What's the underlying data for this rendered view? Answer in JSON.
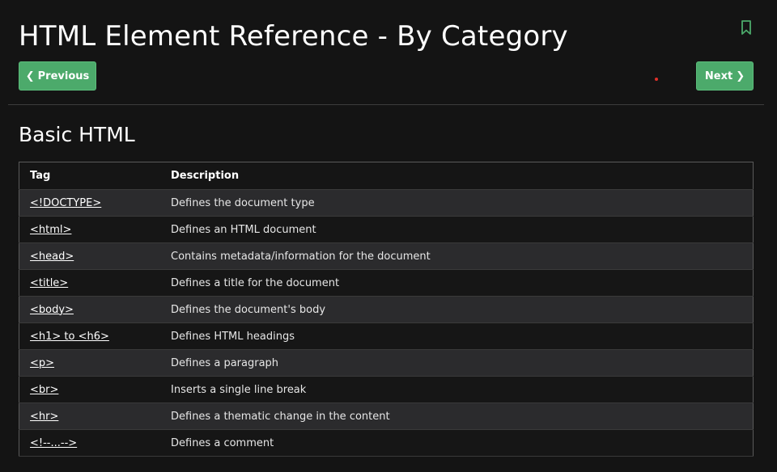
{
  "header": {
    "title": "HTML Element Reference - By Category",
    "bookmark_icon": "bookmark-icon",
    "bookmark_color": "#4caa6b"
  },
  "nav": {
    "previous_label": "Previous",
    "next_label": "Next",
    "button_color": "#4caa6b"
  },
  "section": {
    "title": "Basic HTML"
  },
  "table": {
    "headers": [
      "Tag",
      "Description"
    ],
    "rows": [
      {
        "tag": "<!DOCTYPE>",
        "description": "Defines the document type"
      },
      {
        "tag": "<html>",
        "description": "Defines an HTML document"
      },
      {
        "tag": "<head>",
        "description": "Contains metadata/information for the document"
      },
      {
        "tag": "<title>",
        "description": "Defines a title for the document"
      },
      {
        "tag": "<body>",
        "description": "Defines the document's body"
      },
      {
        "tag": "<h1> to <h6>",
        "description": "Defines HTML headings"
      },
      {
        "tag": "<p>",
        "description": "Defines a paragraph"
      },
      {
        "tag": "<br>",
        "description": "Inserts a single line break"
      },
      {
        "tag": "<hr>",
        "description": "Defines a thematic change in the content"
      },
      {
        "tag": "<!--...-->",
        "description": "Defines a comment"
      }
    ]
  }
}
